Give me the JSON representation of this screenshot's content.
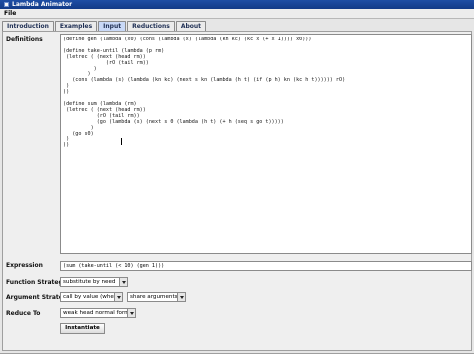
{
  "window": {
    "title": "Lambda Animator"
  },
  "menu": {
    "file": "File"
  },
  "tabs": [
    {
      "label": "Introduction"
    },
    {
      "label": "Examples"
    },
    {
      "label": "Input"
    },
    {
      "label": "Reductions"
    },
    {
      "label": "About"
    }
  ],
  "labels": {
    "definitions": "Definitions",
    "expression": "Expression",
    "function_strategy": "Function Strategy",
    "argument_strategy": "Argument Strategy",
    "reduce_to": "Reduce To"
  },
  "definitions_code": "(define gen (lambda (x0) (cons (lambda (x) (lambda (kn kc) (kc x (+ x 1)))) x0)))\n\n(define take-until (lambda (p rm)\n (letrec ( (next (head rm))\n              (rO (tail rm))\n          )\n        )\n   (cons (lambda (s) (lambda (kn kc) (next s kn (lambda (h t) (if (p h) kn (kc h t)))))) rO)\n )\n))\n\n(define sum (lambda (rm)\n (letrec ( (next (head rm))\n           (rO (tail rm))\n           (go (lambda (s) (next s 0 (lambda (h t) (+ h (seq s go t)))))\n         )\n   (go s0)\n )\n))",
  "expression_value": "(sum (take-until (< 10) (gen 1)))",
  "function_strategy": {
    "selected": "substitute by need"
  },
  "argument_strategy": {
    "selected_a": "call by value (when)",
    "selected_b": "share arguments"
  },
  "reduce_to": {
    "selected": "weak head normal form"
  },
  "button": {
    "instantiate": "Instantiate"
  }
}
